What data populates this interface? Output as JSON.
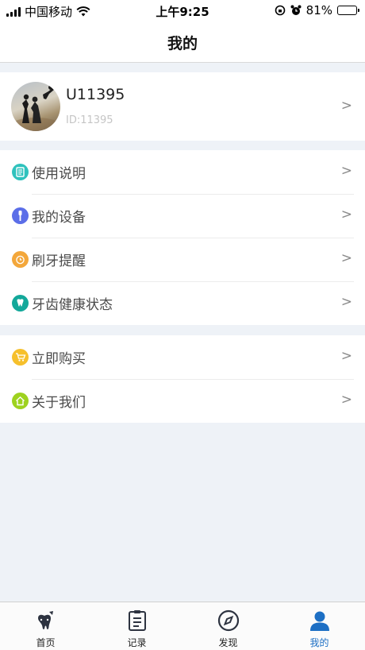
{
  "status_bar": {
    "carrier": "中国移动",
    "time": "上午9:25",
    "battery": "81%"
  },
  "header": {
    "title": "我的"
  },
  "profile": {
    "name": "U11395",
    "id": "ID:11395",
    "chevron": ">"
  },
  "menu_group_1": [
    {
      "label": "使用说明",
      "icon": "manual-icon",
      "color": "#2fc2bd"
    },
    {
      "label": "我的设备",
      "icon": "toothbrush-icon",
      "color": "#5b6ee8"
    },
    {
      "label": "刷牙提醒",
      "icon": "alarm-icon",
      "color": "#f3a73b"
    },
    {
      "label": "牙齿健康状态",
      "icon": "tooth-icon",
      "color": "#13a89a"
    }
  ],
  "menu_group_2": [
    {
      "label": "立即购买",
      "icon": "cart-icon",
      "color": "#f6c02c"
    },
    {
      "label": "关于我们",
      "icon": "home-icon",
      "color": "#9ed21f"
    }
  ],
  "chevron": ">",
  "tabbar": [
    {
      "label": "首页",
      "icon": "tooth-brush-home-icon",
      "active": false
    },
    {
      "label": "记录",
      "icon": "clipboard-icon",
      "active": false
    },
    {
      "label": "发现",
      "icon": "compass-icon",
      "active": false
    },
    {
      "label": "我的",
      "icon": "user-icon",
      "active": true
    }
  ],
  "colors": {
    "accent": "#1d6fc4",
    "background": "#eef2f7",
    "battery": "#34c759"
  }
}
